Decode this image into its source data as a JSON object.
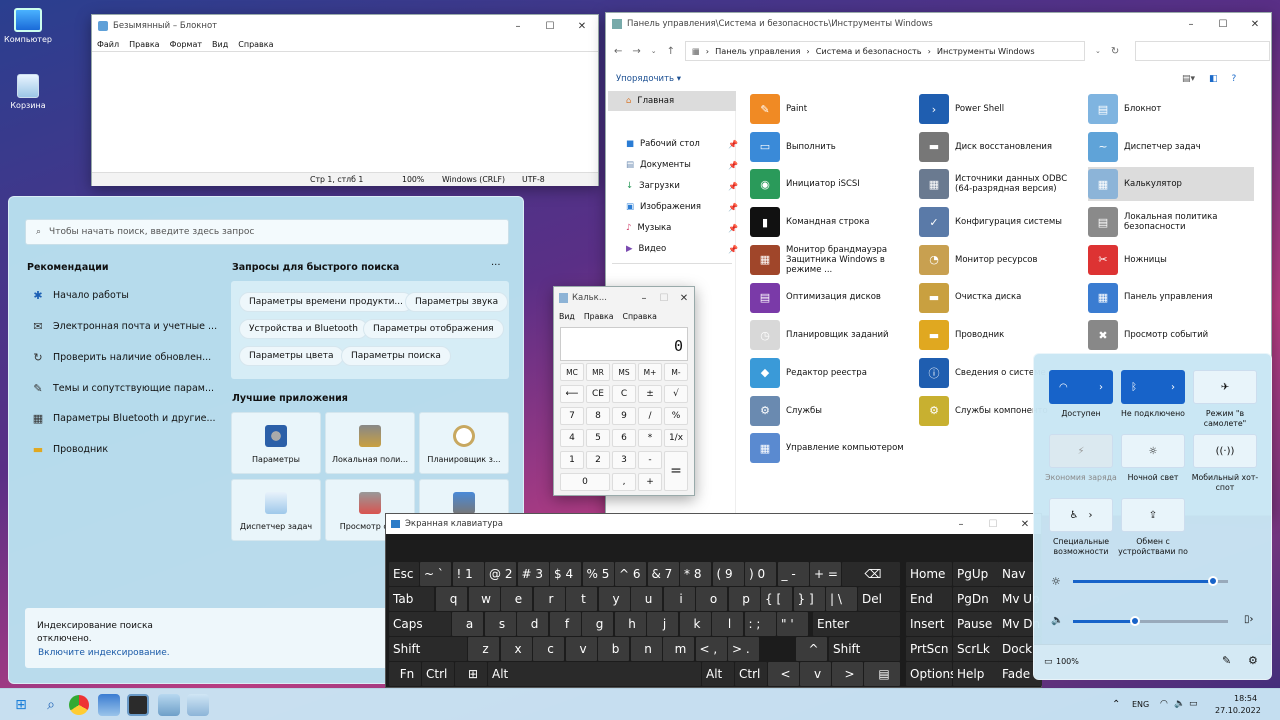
{
  "desktop": {
    "icons": [
      {
        "label": "Компьютер"
      },
      {
        "label": "Корзина"
      }
    ]
  },
  "notepad": {
    "title": "Безымянный – Блокнот",
    "menu": [
      "Файл",
      "Правка",
      "Формат",
      "Вид",
      "Справка"
    ],
    "status": {
      "pos": "Стр 1, стлб 1",
      "zoom": "100%",
      "eol": "Windows (CRLF)",
      "enc": "UTF-8"
    }
  },
  "explorer": {
    "title": "Панель управления\\Система и безопасность\\Инструменты Windows",
    "breadcrumb": [
      "Панель управления",
      "Система и безопасность",
      "Инструменты Windows"
    ],
    "organize": "Упорядочить",
    "nav": [
      {
        "label": "Главная"
      },
      {
        "label": "Рабочий стол"
      },
      {
        "label": "Документы"
      },
      {
        "label": "Загрузки"
      },
      {
        "label": "Изображения"
      },
      {
        "label": "Музыка"
      },
      {
        "label": "Видео"
      }
    ],
    "items": [
      [
        "Paint",
        "Power Shell",
        "Блокнот"
      ],
      [
        "Выполнить",
        "Диск восстановления",
        "Диспетчер задач"
      ],
      [
        "Инициатор iSCSI",
        "Источники данных ODBC (64-разрядная версия)",
        "Калькулятор"
      ],
      [
        "Командная строка",
        "Конфигурация системы",
        "Локальная политика безопасности"
      ],
      [
        "Монитор брандмауэра Защитника Windows в режиме ...",
        "Монитор ресурсов",
        "Ножницы"
      ],
      [
        "Оптимизация дисков",
        "Очистка диска",
        "Панель управления"
      ],
      [
        "Планировщик заданий",
        "Проводник",
        "Просмотр событий"
      ],
      [
        "Редактор реестра",
        "Сведения о системе",
        ""
      ],
      [
        "Службы",
        "Службы компоненто",
        ""
      ],
      [
        "Управление компьютером",
        "",
        ""
      ]
    ]
  },
  "start": {
    "search_placeholder": "Чтобы начать поиск, введите здесь запрос",
    "rec_title": "Рекомендации",
    "recs": [
      "Начало работы",
      "Электронная почта и учетные ...",
      "Проверить наличие обновлен...",
      "Темы и сопутствующие парам...",
      "Параметры Bluetooth и другие...",
      "Проводник"
    ],
    "quick_title": "Запросы для быстрого поиска",
    "more": "···",
    "chips": [
      "Параметры времени продукти...",
      "Параметры звука",
      "Устройства и Bluetooth",
      "Параметры отображения",
      "Параметры цвета",
      "Параметры поиска"
    ],
    "apps_title": "Лучшие приложения",
    "apps": [
      "Параметры",
      "Локальная поли...",
      "Планировщик з...",
      "Диспетчер задач",
      "Просмотр со...",
      ""
    ],
    "index_note": "Индексирование поиска отключено.",
    "index_link": "Включите индексирование."
  },
  "calc": {
    "title": "Кальк...",
    "menu": [
      "Вид",
      "Правка",
      "Справка"
    ],
    "display": "0",
    "keys": [
      [
        "MC",
        "MR",
        "MS",
        "M+",
        "M-"
      ],
      [
        "⟵",
        "CE",
        "C",
        "±",
        "√"
      ],
      [
        "7",
        "8",
        "9",
        "/",
        "%"
      ],
      [
        "4",
        "5",
        "6",
        "*",
        "1/x"
      ],
      [
        "1",
        "2",
        "3",
        "-",
        "="
      ],
      [
        "0",
        ",",
        "+"
      ]
    ]
  },
  "osk": {
    "title": "Экранная клавиатура",
    "row1": [
      "Esc",
      "~ `",
      "! 1",
      "@ 2",
      "# 3",
      "$ 4",
      "% 5",
      "^ 6",
      "& 7",
      "* 8",
      "( 9",
      ") 0",
      "_ -",
      "+ =",
      "⌫",
      "Home",
      "PgUp",
      "Nav"
    ],
    "row2": [
      "Tab",
      "q",
      "w",
      "e",
      "r",
      "t",
      "y",
      "u",
      "i",
      "o",
      "p",
      "{ [",
      "} ]",
      "| \\",
      "Del",
      "End",
      "PgDn",
      "Mv Up"
    ],
    "row3": [
      "Caps",
      "a",
      "s",
      "d",
      "f",
      "g",
      "h",
      "j",
      "k",
      "l",
      ": ;",
      "\" '",
      "Enter",
      "Insert",
      "Pause",
      "Mv Dn"
    ],
    "row4": [
      "Shift",
      "z",
      "x",
      "c",
      "v",
      "b",
      "n",
      "m",
      "< ,",
      "> .",
      "^",
      "Shift",
      "PrtScn",
      "ScrLk",
      "Dock"
    ],
    "row5": [
      "Fn",
      "Ctrl",
      "⊞",
      "Alt",
      "Alt",
      "Ctrl",
      "<",
      "v",
      ">",
      "▤",
      "Options",
      "Help",
      "Fade"
    ]
  },
  "quick": {
    "tiles": [
      {
        "label": "Доступен"
      },
      {
        "label": "Не подключено"
      },
      {
        "label": "Режим \"в самолете\""
      },
      {
        "label": "Экономия заряда"
      },
      {
        "label": "Ночной свет"
      },
      {
        "label": "Мобильный хот-спот"
      },
      {
        "label": "Специальные возможности"
      },
      {
        "label": "Обмен с устройствами по"
      }
    ],
    "brightness": 0.9,
    "volume": 0.4,
    "battery": "100%"
  },
  "taskbar": {
    "lang": "ENG",
    "time": "18:54",
    "date": "27.10.2022"
  }
}
